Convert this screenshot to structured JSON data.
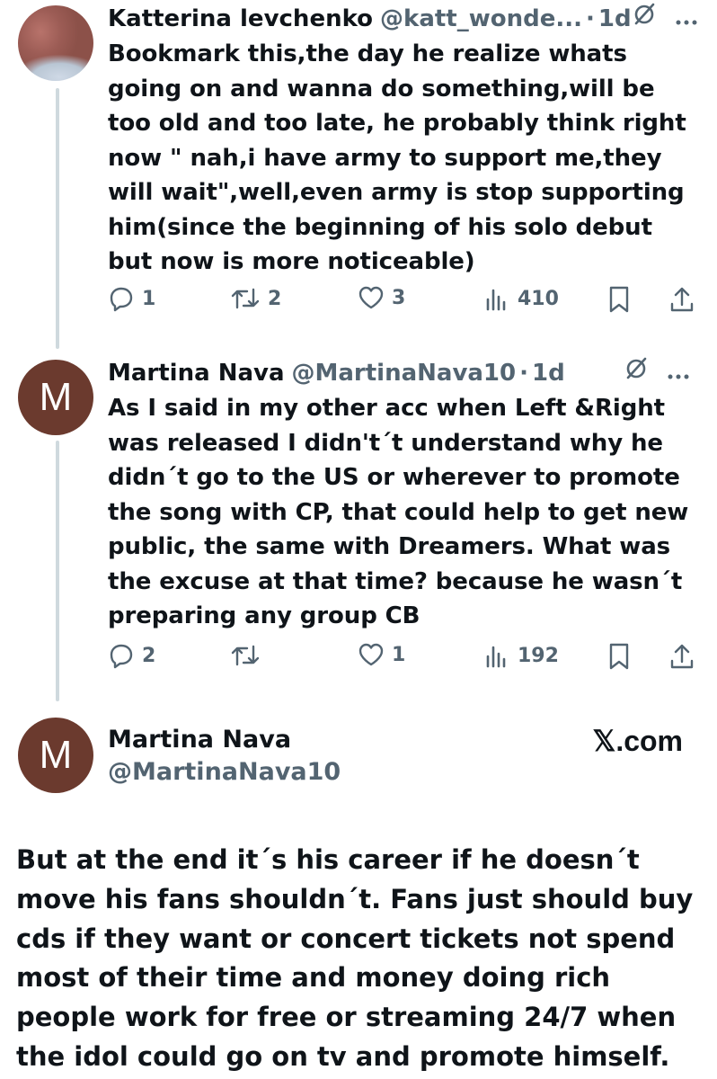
{
  "tweet1": {
    "name": "Katterina levchenko",
    "handle": "@katt_wonde...",
    "separator": "·",
    "time": "1d",
    "text": "Bookmark this,the day he realize whats going on and wanna do something,will be too old and too late, he probably think right now \" nah,i have army to support me,they will wait\",well,even army is stop supporting him(since the beginning of his solo debut but now is more noticeable)",
    "replies": "1",
    "reposts": "2",
    "likes": "3",
    "views": "410"
  },
  "tweet2": {
    "name": "Martina Nava",
    "avatar_letter": "M",
    "handle": "@MartinaNava10",
    "separator": "·",
    "time": "1d",
    "text": "As I said in my other acc when Left &Right was released I didn't´t understand why he didn´t go to the US or wherever to promote the song with CP, that could help to get new public, the same with Dreamers. What was the excuse at that time? because he wasn´t preparing any group CB",
    "replies": "2",
    "reposts": "",
    "likes": "1",
    "views": "192"
  },
  "quote": {
    "name": "Martina Nava",
    "avatar_letter": "M",
    "handle": "@MartinaNava10",
    "brand": "𝕏.com",
    "text": "But at the end it´s his career if he doesn´t move his fans shouldn´t. Fans just should buy cds if they want or concert tickets not spend most of their time and money doing rich people work for free or streaming 24/7 when the idol could go on tv and promote himself."
  },
  "icons": {
    "reply": "reply-icon",
    "repost": "repost-icon",
    "like": "like-icon",
    "views": "views-icon",
    "bookmark": "bookmark-icon",
    "share": "share-icon",
    "grok": "grok-icon",
    "more": "more-icon"
  },
  "colors": {
    "text": "#0f1419",
    "secondary": "#536471",
    "thread_line": "#cfd9de",
    "avatar_m": "#6b3a2e"
  }
}
